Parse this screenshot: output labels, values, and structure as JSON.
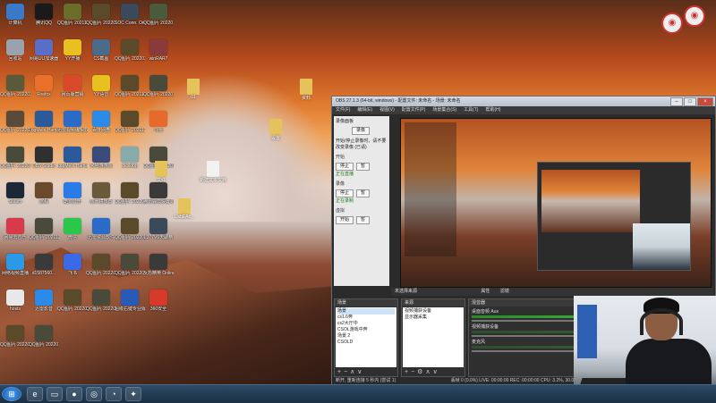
{
  "desktop": {
    "icons": [
      {
        "label": "计算机",
        "color": "#3a78c8"
      },
      {
        "label": "腾讯QQ",
        "color": "#1a1a1a"
      },
      {
        "label": "QQ图片 20211212...",
        "color": "#6b6b2a"
      },
      {
        "label": "QQ图片 20220118...",
        "color": "#5a4a2a"
      },
      {
        "label": "SOC Conn. Online",
        "color": "#3a4a5a"
      },
      {
        "label": "QQ图片 20220127...",
        "color": "#4a5a3a"
      },
      {
        "label": "回收站",
        "color": "#9aa3ad"
      },
      {
        "label": "网易UU加速器",
        "color": "#5a6ec8"
      },
      {
        "label": "YY开播",
        "color": "#e8c020"
      },
      {
        "label": "CS截图",
        "color": "#4a6a8a"
      },
      {
        "label": "QQ图片 20220214...",
        "color": "#5a4a2a"
      },
      {
        "label": "winRAR7",
        "color": "#8a3a3a"
      },
      {
        "label": "QQ图片 20220205...",
        "color": "#5a5a3a"
      },
      {
        "label": "Firefox",
        "color": "#e8702a"
      },
      {
        "label": "网页版营销",
        "color": "#d84a2a"
      },
      {
        "label": "YY语音",
        "color": "#e8c020"
      },
      {
        "label": "QQ图片 20211212...",
        "color": "#5a4a2a"
      },
      {
        "label": "QQ图片 20220120...",
        "color": "#4a4a3a"
      },
      {
        "label": "QQ图片 20220210...",
        "color": "#5a4a3a"
      },
      {
        "label": "LogMeIn Hamachi",
        "color": "#2a5a9a"
      },
      {
        "label": "迅雷视频编辑软件",
        "color": "#2a6ac8"
      },
      {
        "label": "百度网盘",
        "color": "#2a8ae8"
      },
      {
        "label": "QQ图片 20211220...",
        "color": "#5a4a2a"
      },
      {
        "label": "斗鱼",
        "color": "#e86a2a"
      },
      {
        "label": "QQ图片 20220120...",
        "color": "#4a4a3a"
      },
      {
        "label": "OBS Studio",
        "color": "#303030"
      },
      {
        "label": "LogMeIn Hamachi",
        "color": "#2a5a9a"
      },
      {
        "label": "米哈游游戏",
        "color": "#3a4a7a"
      },
      {
        "label": "desktop",
        "color": "#8aa"
      },
      {
        "label": "QQ图片 20220120...",
        "color": "#4a4a3a"
      },
      {
        "label": "Steam",
        "color": "#1b2838"
      },
      {
        "label": "旅程",
        "color": "#6a4a2a"
      },
      {
        "label": "酷狗音乐",
        "color": "#2a7ae8"
      },
      {
        "label": "放大镜放置",
        "color": "#6a5a3a"
      },
      {
        "label": "QQ图片 20220120...",
        "color": "#5a4a2a"
      },
      {
        "label": "腾讯会员设置记录",
        "color": "#3a3a3a"
      },
      {
        "label": "网易云音乐",
        "color": "#d83a4a"
      },
      {
        "label": "QQ图片 20211202...",
        "color": "#4a4a3a"
      },
      {
        "label": "微信",
        "color": "#2ac84a"
      },
      {
        "label": "迅雷资源软件",
        "color": "#2a6ac8"
      },
      {
        "label": "QQ图片 20220206...",
        "color": "#5a4a2a"
      },
      {
        "label": "L377V6天聊精",
        "color": "#3a4a5a"
      },
      {
        "label": "网络视频直播",
        "color": "#2a9ae8"
      },
      {
        "label": "d1587560...",
        "color": "#3a3a3a"
      },
      {
        "label": "飞书",
        "color": "#3a6ae8"
      },
      {
        "label": "QQ图片 20220118...",
        "color": "#5a4a2a"
      },
      {
        "label": "QQ图片 20220120...",
        "color": "#4a4a3a"
      },
      {
        "label": "反恐精英 Online",
        "color": "#3a3a3a"
      },
      {
        "label": "hosts",
        "color": "#e8e8e8"
      },
      {
        "label": "迅雷影音",
        "color": "#2a8ae8"
      },
      {
        "label": "QQ图片 20220119...",
        "color": "#5a4a2a"
      },
      {
        "label": "QQ图片 20220120...",
        "color": "#4a4a3a"
      },
      {
        "label": "超级右键专业版",
        "color": "#2a5ab8"
      },
      {
        "label": "360安全",
        "color": "#d83a2a"
      },
      {
        "label": "QQ图片 20220118...",
        "color": "#5a4a2a"
      },
      {
        "label": "QQ图片 20220124...",
        "color": "#4a4a3a"
      }
    ],
    "loose": [
      {
        "label": "资料"
      },
      {
        "label": "01"
      },
      {
        "label": "设置"
      },
      {
        "label": "文件"
      },
      {
        "label": "UsbEAs..."
      },
      {
        "label": "新建文本文档"
      }
    ]
  },
  "obs": {
    "title": "OBS 27.1.3 (64-bit, windows) - 配置文件: 未命名 - 场景: 未命名",
    "menu": [
      "文件(F)",
      "编辑(E)",
      "视图(V)",
      "配置文件(P)",
      "场景集合(S)",
      "工具(T)",
      "帮助(H)"
    ],
    "left_panel": {
      "header": "录像面板",
      "record_btn": "录像",
      "note": "开始/停止录像时，请不要改变录像 (已请)",
      "sections": [
        {
          "title": "开始",
          "btn1": "停止",
          "btn2": "暂",
          "status": "正在直播"
        },
        {
          "title": "录像",
          "btn1": "停止",
          "btn2": "暂",
          "status": "正在录制"
        },
        {
          "title": "虚拟",
          "btn1": "开始",
          "btn2": "暂"
        }
      ]
    },
    "preview_status": "未选择来源",
    "filter_label": "属性",
    "filters_label": "滤镜",
    "docks": {
      "scenes": {
        "title": "场景",
        "items": [
          "场景",
          "cs1.6奔",
          "cs2大厅中",
          "CSOL游戏中奔",
          "场景 2",
          "CSOLD"
        ]
      },
      "sources": {
        "title": "来源",
        "items": [
          "视频捕获设备",
          "显示器采集"
        ]
      },
      "mixer": {
        "title": "混音器",
        "rows": [
          {
            "name": "桌面音频 Aux",
            "level": "0.0 dB"
          },
          {
            "name": "视频捕获设备",
            "level": "0.0 dB"
          },
          {
            "name": "麦克风",
            "level": "0.0 dB"
          }
        ]
      }
    },
    "statusbar": "断开, 重新连接 5 秒内 (尝试 1)",
    "stats": "丢帧 0 (0.0%)  LIVE: 00:00:00  REC: 00:00:00  CPU: 3.2%, 30.00 fps"
  },
  "taskbar": {
    "start_icon": "windows-icon",
    "items": [
      "ie-icon",
      "explorer-icon",
      "obs-icon",
      "steam-icon",
      "recycle-icon",
      "cs-icon"
    ]
  }
}
